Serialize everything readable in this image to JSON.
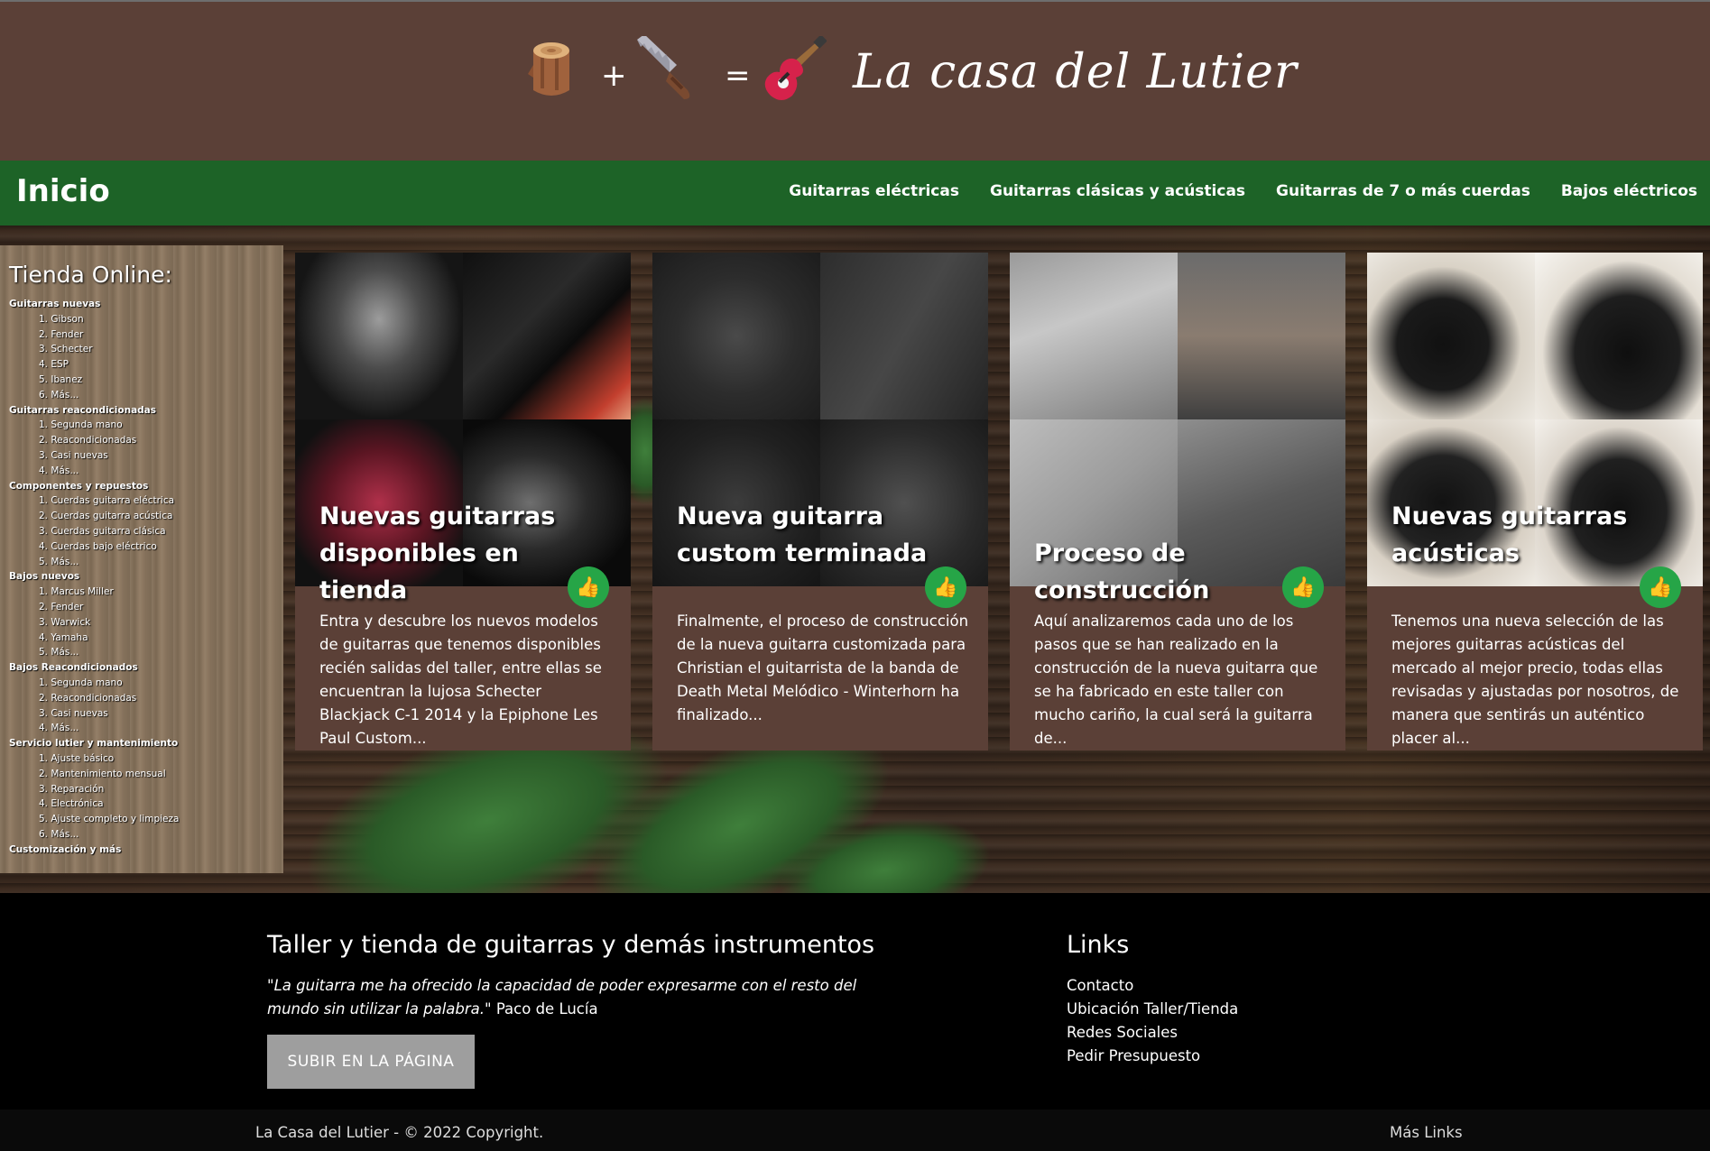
{
  "header": {
    "logo_plus": "+",
    "logo_equals": "=",
    "logo_title": "La casa del Lutier",
    "logo_icons": [
      "wood-log-icon",
      "saw-icon",
      "electric-guitar-icon"
    ]
  },
  "nav": {
    "brand": "Inicio",
    "links": [
      "Guitarras eléctricas",
      "Guitarras clásicas y acústicas",
      "Guitarras de 7 o más cuerdas",
      "Bajos eléctricos"
    ]
  },
  "sidebar": {
    "title": "Tienda Online:",
    "categories": [
      {
        "label": "Guitarras nuevas",
        "items": [
          "1. Gibson",
          "2. Fender",
          "3. Schecter",
          "4. ESP",
          "5. Ibanez",
          "6. Más..."
        ]
      },
      {
        "label": "Guitarras reacondicionadas",
        "items": [
          "1. Segunda mano",
          "2. Reacondicionadas",
          "3. Casi nuevas",
          "4. Más..."
        ]
      },
      {
        "label": "Componentes y repuestos",
        "items": [
          "1. Cuerdas guitarra eléctrica",
          "2. Cuerdas guitarra acústica",
          "3. Cuerdas guitarra clásica",
          "4. Cuerdas bajo eléctrico",
          "5. Más..."
        ]
      },
      {
        "label": "Bajos nuevos",
        "items": [
          "1. Marcus Miller",
          "2. Fender",
          "3. Warwick",
          "4. Yamaha",
          "5. Más..."
        ]
      },
      {
        "label": "Bajos Reacondicionados",
        "items": [
          "1. Segunda mano",
          "2. Reacondicionadas",
          "3. Casi nuevas",
          "4. Más..."
        ]
      },
      {
        "label": "Servicio lutier y mantenimiento",
        "items": [
          "1. Ajuste básico",
          "2. Mantenimiento mensual",
          "3. Reparación",
          "4. Electrónica",
          "5. Ajuste completo y limpieza",
          "6. Más..."
        ]
      },
      {
        "label": "Customización y más",
        "items": []
      }
    ]
  },
  "cards": [
    {
      "title": "Nuevas guitarras disponibles en tienda",
      "text": "Entra y descubre los nuevos modelos de guitarras que tenemos disponibles recién salidas del taller, entre ellas se encuentran la lujosa Schecter Blackjack C-1 2014 y la Epiphone Les Paul Custom...",
      "like_icon": "thumbs-up-icon"
    },
    {
      "title": "Nueva guitarra custom terminada",
      "text": "Finalmente, el proceso de construcción de la nueva guitarra customizada para Christian el guitarrista de la banda de Death Metal Melódico - Winterhorn ha finalizado...",
      "like_icon": "thumbs-up-icon"
    },
    {
      "title": "Proceso de construcción",
      "text": "Aquí analizaremos cada uno de los pasos que se han realizado en la construcción de la nueva guitarra que se ha fabricado en este taller con mucho cariño, la cual será la guitarra de...",
      "like_icon": "thumbs-up-icon"
    },
    {
      "title": "Nuevas guitarras acústicas",
      "text": "Tenemos una nueva selección de las mejores guitarras acústicas del mercado al mejor precio, todas ellas revisadas y ajustadas por nosotros, de manera que sentirás un auténtico placer al...",
      "like_icon": "thumbs-up-icon"
    }
  ],
  "footer": {
    "title": "Taller y tienda de guitarras y demás instrumentos",
    "quote": "\"La guitarra me ha ofrecido la capacidad de poder expresarme con el resto del mundo sin utilizar la palabra.\"",
    "quote_author": "Paco de Lucía",
    "button": "SUBIR EN LA PÁGINA",
    "links_title": "Links",
    "links": [
      "Contacto",
      "Ubicación Taller/Tienda",
      "Redes Sociales",
      "Pedir Presupuesto"
    ],
    "copyright": "La Casa del Lutier - © 2022 Copyright.",
    "more_links": "Más Links"
  },
  "colors": {
    "header_bg": "#5b4037",
    "nav_bg": "#1d6327",
    "card_bg": "#5b4037",
    "like_bg": "#26a547",
    "footer_bg": "#000000",
    "button_bg": "#9e9e9e"
  }
}
